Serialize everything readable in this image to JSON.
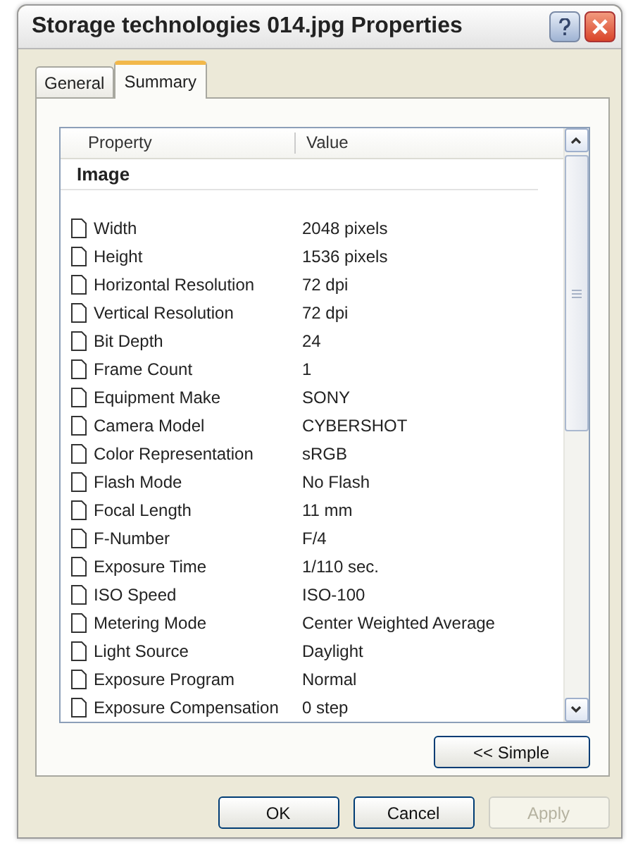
{
  "window": {
    "title": "Storage technologies 014.jpg Properties"
  },
  "tabs": [
    {
      "label": "General",
      "selected": false
    },
    {
      "label": "Summary",
      "selected": true
    }
  ],
  "list": {
    "columns": [
      "Property",
      "Value"
    ],
    "group": "Image",
    "rows": [
      {
        "name": "Width",
        "value": "2048 pixels"
      },
      {
        "name": "Height",
        "value": "1536 pixels"
      },
      {
        "name": "Horizontal Resolution",
        "value": "72 dpi"
      },
      {
        "name": "Vertical Resolution",
        "value": "72 dpi"
      },
      {
        "name": "Bit Depth",
        "value": "24"
      },
      {
        "name": "Frame Count",
        "value": "1"
      },
      {
        "name": "Equipment Make",
        "value": "SONY"
      },
      {
        "name": "Camera Model",
        "value": "CYBERSHOT"
      },
      {
        "name": "Color Representation",
        "value": "sRGB"
      },
      {
        "name": "Flash Mode",
        "value": "No Flash"
      },
      {
        "name": "Focal Length",
        "value": "11 mm"
      },
      {
        "name": "F-Number",
        "value": "F/4"
      },
      {
        "name": "Exposure Time",
        "value": "1/110 sec."
      },
      {
        "name": "ISO Speed",
        "value": "ISO-100"
      },
      {
        "name": "Metering Mode",
        "value": "Center Weighted Average"
      },
      {
        "name": "Light Source",
        "value": "Daylight"
      },
      {
        "name": "Exposure Program",
        "value": "Normal"
      },
      {
        "name": "Exposure Compensation",
        "value": "0 step"
      }
    ]
  },
  "view_button": "<< Simple",
  "buttons": [
    {
      "label": "OK",
      "disabled": false
    },
    {
      "label": "Cancel",
      "disabled": false
    },
    {
      "label": "Apply",
      "disabled": true
    }
  ]
}
